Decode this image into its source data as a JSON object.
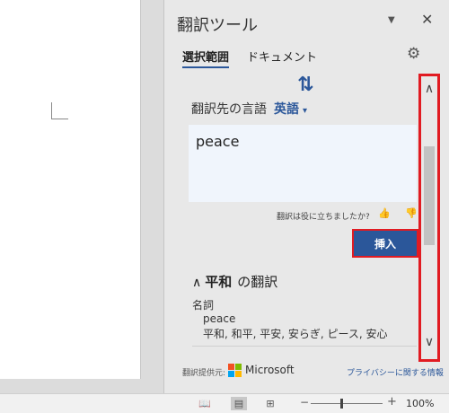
{
  "pane": {
    "title": "翻訳ツール",
    "menu_icon": "▼",
    "close_icon": "✕",
    "tabs": [
      {
        "label": "選択範囲",
        "active": true
      },
      {
        "label": "ドキュメント",
        "active": false
      }
    ],
    "gear_icon": "⚙",
    "swap_icon": "⇅"
  },
  "translation": {
    "target_label": "翻訳先の言語",
    "target_language": "英語",
    "caret": "▾",
    "result": "peace"
  },
  "feedback": {
    "question": "翻訳は役に立ちましたか?",
    "thumb_up": "👍",
    "thumb_down": "👎"
  },
  "insert_label": "挿入",
  "dictionary": {
    "chevron": "∧",
    "word": "平和",
    "heading_suffix": "の翻訳",
    "part_of_speech": "名詞",
    "definition": "peace",
    "alternatives": "平和, 和平, 平安, 安らぎ, ピース, 安心"
  },
  "provider": {
    "label": "翻訳提供元:",
    "name": "Microsoft",
    "logo_colors": [
      "#f25022",
      "#7fba00",
      "#00a4ef",
      "#ffb900"
    ]
  },
  "privacy_link": "プライバシーに関する情報",
  "scrollbar": {
    "up_icon": "∧",
    "down_icon": "∨"
  },
  "statusbar": {
    "read_icon": "📖",
    "print_icon": "▤",
    "web_icon": "⊞",
    "zoom_minus": "−",
    "zoom_plus": "+",
    "zoom_level": "100%"
  },
  "colors": {
    "accent": "#2b579a",
    "highlight": "#e11b22"
  }
}
